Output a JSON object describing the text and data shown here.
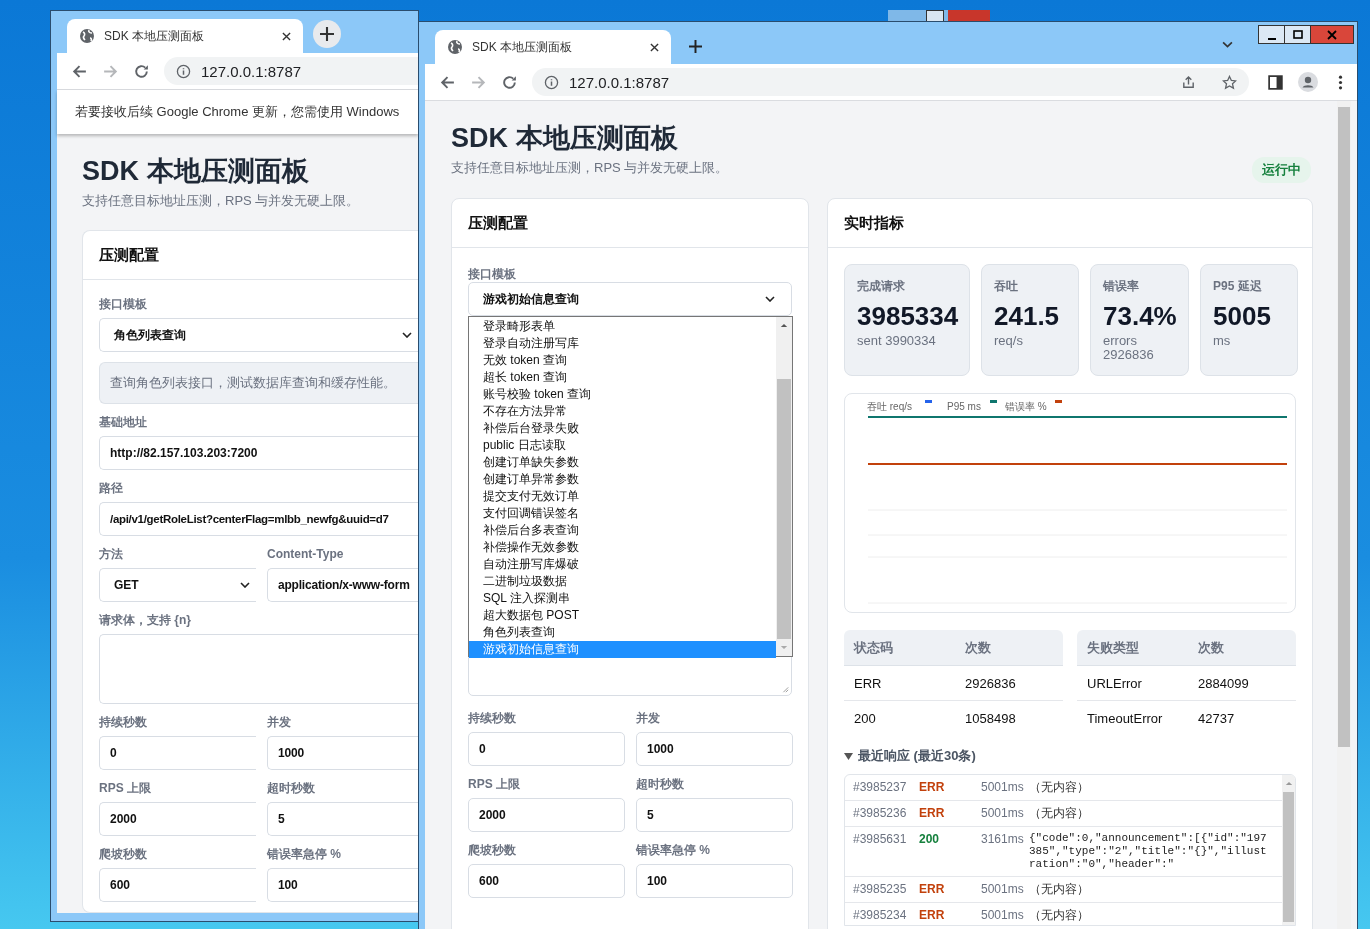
{
  "back_window": {
    "tab_title": "SDK 本地压测面板",
    "url": "127.0.0.1:8787",
    "infobar": "若要接收后续 Google Chrome 更新，您需使用 Windows",
    "page_title": "SDK 本地压测面板",
    "subtitle": "支持任意目标地址压测，RPS 与并发无硬上限。",
    "card_title": "压测配置",
    "rows": [
      [
        {
          "kind": "select",
          "label": "接口模板",
          "value": "角色列表查询"
        }
      ],
      [
        {
          "kind": "note",
          "value": "查询角色列表接口，测试数据库查询和缓存性能。"
        }
      ],
      [
        {
          "kind": "input",
          "label": "基础地址",
          "value": "http://82.157.103.203:7200"
        }
      ],
      [
        {
          "kind": "input",
          "label": "路径",
          "value": "/api/v1/getRoleList?centerFlag=mlbb_newfg&uuid=d7"
        }
      ],
      [
        {
          "kind": "select",
          "label": "方法",
          "value": "GET"
        },
        {
          "kind": "input",
          "label": "Content-Type",
          "value": "application/x-www-form"
        }
      ],
      [
        {
          "kind": "textarea",
          "label": "请求体，支持 {n}"
        }
      ],
      [
        {
          "kind": "input",
          "label": "持续秒数",
          "value": "0"
        },
        {
          "kind": "input",
          "label": "并发",
          "value": "1000"
        }
      ],
      [
        {
          "kind": "input",
          "label": "RPS 上限",
          "value": "2000"
        },
        {
          "kind": "input",
          "label": "超时秒数",
          "value": "5"
        }
      ],
      [
        {
          "kind": "input",
          "label": "爬坡秒数",
          "value": "600"
        },
        {
          "kind": "input",
          "label": "错误率急停 %",
          "value": "100"
        }
      ]
    ]
  },
  "front_window": {
    "tab_title": "SDK 本地压测面板",
    "url": "127.0.0.1:8787",
    "page_title": "SDK 本地压测面板",
    "subtitle": "支持任意目标地址压测，RPS 与并发无硬上限。",
    "status_badge": "运行中",
    "config": {
      "title": "压测配置",
      "template_label": "接口模板",
      "template_value": "游戏初始信息查询",
      "dropdown_open": true,
      "options": [
        {
          "label": "登录畸形表单",
          "selected": false
        },
        {
          "label": "登录自动注册写库",
          "selected": false
        },
        {
          "label": "无效 token 查询",
          "selected": false
        },
        {
          "label": "超长 token 查询",
          "selected": false
        },
        {
          "label": "账号校验 token 查询",
          "selected": false
        },
        {
          "label": "不存在方法异常",
          "selected": false
        },
        {
          "label": "补偿后台登录失败",
          "selected": false
        },
        {
          "label": "public 日志读取",
          "selected": false
        },
        {
          "label": "创建订单缺失参数",
          "selected": false
        },
        {
          "label": "创建订单异常参数",
          "selected": false
        },
        {
          "label": "提交支付无效订单",
          "selected": false
        },
        {
          "label": "支付回调错误签名",
          "selected": false
        },
        {
          "label": "补偿后台多表查询",
          "selected": false
        },
        {
          "label": "补偿操作无效参数",
          "selected": false
        },
        {
          "label": "自动注册写库爆破",
          "selected": false
        },
        {
          "label": "二进制垃圾数据",
          "selected": false
        },
        {
          "label": "SQL 注入探测串",
          "selected": false
        },
        {
          "label": "超大数据包 POST",
          "selected": false
        },
        {
          "label": "角色列表查询",
          "selected": false
        },
        {
          "label": "游戏初始信息查询",
          "selected": true
        }
      ],
      "rows": [
        [
          {
            "label": "持续秒数",
            "value": "0"
          },
          {
            "label": "并发",
            "value": "1000"
          }
        ],
        [
          {
            "label": "RPS 上限",
            "value": "2000"
          },
          {
            "label": "超时秒数",
            "value": "5"
          }
        ],
        [
          {
            "label": "爬坡秒数",
            "value": "600"
          },
          {
            "label": "错误率急停 %",
            "value": "100"
          }
        ]
      ]
    },
    "metrics": {
      "title": "实时指标",
      "stats": [
        {
          "label": "完成请求",
          "value": "3985334",
          "sub": "sent 3990334"
        },
        {
          "label": "吞吐",
          "value": "241.5",
          "sub": "req/s"
        },
        {
          "label": "错误率",
          "value": "73.4%",
          "sub": "errors 2926836"
        },
        {
          "label": "P95 延迟",
          "value": "5005",
          "sub": "ms"
        }
      ],
      "chart_legend": [
        {
          "label": "吞吐 req/s",
          "color": "#2563eb"
        },
        {
          "label": "P95 ms",
          "color": "#0f766e"
        },
        {
          "label": "错误率 %",
          "color": "#c2410c"
        }
      ],
      "status_table": {
        "columns": [
          "状态码",
          "次数"
        ],
        "rows": [
          [
            "ERR",
            "2926836"
          ],
          [
            "200",
            "1058498"
          ]
        ]
      },
      "failure_table": {
        "columns": [
          "失败类型",
          "次数"
        ],
        "rows": [
          [
            "URLError",
            "2884099"
          ],
          [
            "TimeoutError",
            "42737"
          ]
        ]
      },
      "recent": {
        "title": "最近响应 (最近30条)",
        "expanded": true,
        "rows": [
          {
            "id": "#3985237",
            "status": "ERR",
            "color": "#c2410c",
            "ms": "5001ms",
            "body": "（无内容）",
            "kind": "text"
          },
          {
            "id": "#3985236",
            "status": "ERR",
            "color": "#c2410c",
            "ms": "5001ms",
            "body": "（无内容）",
            "kind": "text"
          },
          {
            "id": "#3985631",
            "status": "200",
            "color": "#15803d",
            "ms": "3161ms",
            "body": "{\"code\":0,\"announcement\":[{\"id\":\"197385\",\"type\":\"2\",\"title\":\"{}\",\"illustration\":\"0\",\"header\":\"",
            "kind": "code"
          },
          {
            "id": "#3985235",
            "status": "ERR",
            "color": "#c2410c",
            "ms": "5001ms",
            "body": "（无内容）",
            "kind": "text"
          },
          {
            "id": "#3985234",
            "status": "ERR",
            "color": "#c2410c",
            "ms": "5001ms",
            "body": "（无内容）",
            "kind": "text"
          }
        ]
      }
    }
  }
}
